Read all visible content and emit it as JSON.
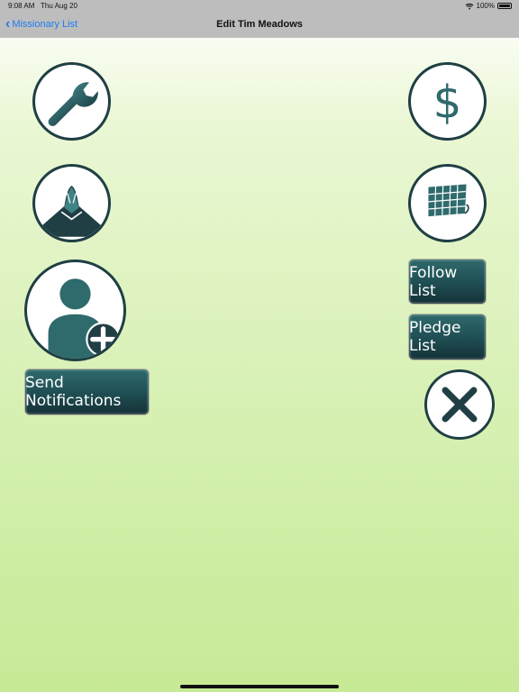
{
  "status_bar": {
    "time": "9:08 AM",
    "date": "Thu Aug 20",
    "battery": "100%",
    "wifi_icon": "wifi-icon"
  },
  "nav": {
    "back_label": "Missionary List",
    "title": "Edit Tim Meadows"
  },
  "buttons": {
    "send_notifications": "Send Notifications",
    "follow_list": "Follow List",
    "pledge_list": "Pledge List"
  },
  "icons": {
    "wrench": "wrench-icon",
    "dollar": "dollar-icon",
    "praying_hands": "praying-hands-icon",
    "calendar": "calendar-icon",
    "add_person": "add-person-icon",
    "close": "close-icon"
  },
  "colors": {
    "accent": "#1e7cf2",
    "icon_dark": "#1f3f44",
    "icon_teal": "#2f6a6c"
  }
}
